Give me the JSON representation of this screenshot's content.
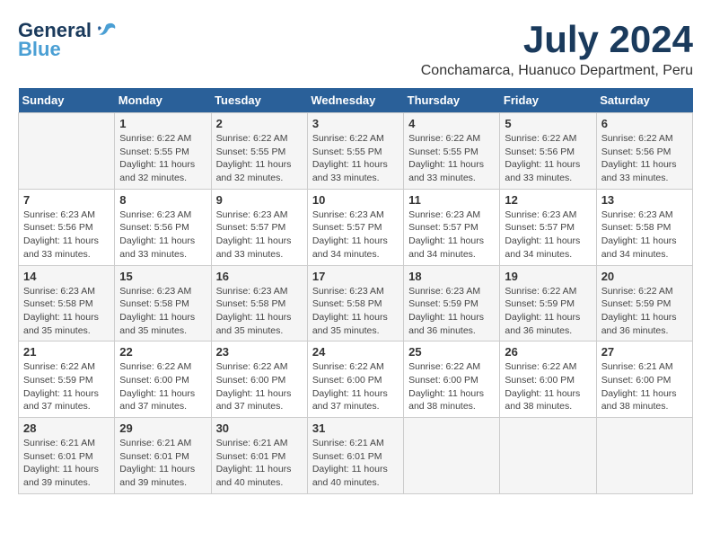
{
  "logo": {
    "general": "General",
    "blue": "Blue"
  },
  "title": {
    "month_year": "July 2024",
    "location": "Conchamarca, Huanuco Department, Peru"
  },
  "headers": [
    "Sunday",
    "Monday",
    "Tuesday",
    "Wednesday",
    "Thursday",
    "Friday",
    "Saturday"
  ],
  "weeks": [
    [
      {
        "day": "",
        "info": ""
      },
      {
        "day": "1",
        "info": "Sunrise: 6:22 AM\nSunset: 5:55 PM\nDaylight: 11 hours\nand 32 minutes."
      },
      {
        "day": "2",
        "info": "Sunrise: 6:22 AM\nSunset: 5:55 PM\nDaylight: 11 hours\nand 32 minutes."
      },
      {
        "day": "3",
        "info": "Sunrise: 6:22 AM\nSunset: 5:55 PM\nDaylight: 11 hours\nand 33 minutes."
      },
      {
        "day": "4",
        "info": "Sunrise: 6:22 AM\nSunset: 5:55 PM\nDaylight: 11 hours\nand 33 minutes."
      },
      {
        "day": "5",
        "info": "Sunrise: 6:22 AM\nSunset: 5:56 PM\nDaylight: 11 hours\nand 33 minutes."
      },
      {
        "day": "6",
        "info": "Sunrise: 6:22 AM\nSunset: 5:56 PM\nDaylight: 11 hours\nand 33 minutes."
      }
    ],
    [
      {
        "day": "7",
        "info": "Sunrise: 6:23 AM\nSunset: 5:56 PM\nDaylight: 11 hours\nand 33 minutes."
      },
      {
        "day": "8",
        "info": "Sunrise: 6:23 AM\nSunset: 5:56 PM\nDaylight: 11 hours\nand 33 minutes."
      },
      {
        "day": "9",
        "info": "Sunrise: 6:23 AM\nSunset: 5:57 PM\nDaylight: 11 hours\nand 33 minutes."
      },
      {
        "day": "10",
        "info": "Sunrise: 6:23 AM\nSunset: 5:57 PM\nDaylight: 11 hours\nand 34 minutes."
      },
      {
        "day": "11",
        "info": "Sunrise: 6:23 AM\nSunset: 5:57 PM\nDaylight: 11 hours\nand 34 minutes."
      },
      {
        "day": "12",
        "info": "Sunrise: 6:23 AM\nSunset: 5:57 PM\nDaylight: 11 hours\nand 34 minutes."
      },
      {
        "day": "13",
        "info": "Sunrise: 6:23 AM\nSunset: 5:58 PM\nDaylight: 11 hours\nand 34 minutes."
      }
    ],
    [
      {
        "day": "14",
        "info": "Sunrise: 6:23 AM\nSunset: 5:58 PM\nDaylight: 11 hours\nand 35 minutes."
      },
      {
        "day": "15",
        "info": "Sunrise: 6:23 AM\nSunset: 5:58 PM\nDaylight: 11 hours\nand 35 minutes."
      },
      {
        "day": "16",
        "info": "Sunrise: 6:23 AM\nSunset: 5:58 PM\nDaylight: 11 hours\nand 35 minutes."
      },
      {
        "day": "17",
        "info": "Sunrise: 6:23 AM\nSunset: 5:58 PM\nDaylight: 11 hours\nand 35 minutes."
      },
      {
        "day": "18",
        "info": "Sunrise: 6:23 AM\nSunset: 5:59 PM\nDaylight: 11 hours\nand 36 minutes."
      },
      {
        "day": "19",
        "info": "Sunrise: 6:22 AM\nSunset: 5:59 PM\nDaylight: 11 hours\nand 36 minutes."
      },
      {
        "day": "20",
        "info": "Sunrise: 6:22 AM\nSunset: 5:59 PM\nDaylight: 11 hours\nand 36 minutes."
      }
    ],
    [
      {
        "day": "21",
        "info": "Sunrise: 6:22 AM\nSunset: 5:59 PM\nDaylight: 11 hours\nand 37 minutes."
      },
      {
        "day": "22",
        "info": "Sunrise: 6:22 AM\nSunset: 6:00 PM\nDaylight: 11 hours\nand 37 minutes."
      },
      {
        "day": "23",
        "info": "Sunrise: 6:22 AM\nSunset: 6:00 PM\nDaylight: 11 hours\nand 37 minutes."
      },
      {
        "day": "24",
        "info": "Sunrise: 6:22 AM\nSunset: 6:00 PM\nDaylight: 11 hours\nand 37 minutes."
      },
      {
        "day": "25",
        "info": "Sunrise: 6:22 AM\nSunset: 6:00 PM\nDaylight: 11 hours\nand 38 minutes."
      },
      {
        "day": "26",
        "info": "Sunrise: 6:22 AM\nSunset: 6:00 PM\nDaylight: 11 hours\nand 38 minutes."
      },
      {
        "day": "27",
        "info": "Sunrise: 6:21 AM\nSunset: 6:00 PM\nDaylight: 11 hours\nand 38 minutes."
      }
    ],
    [
      {
        "day": "28",
        "info": "Sunrise: 6:21 AM\nSunset: 6:01 PM\nDaylight: 11 hours\nand 39 minutes."
      },
      {
        "day": "29",
        "info": "Sunrise: 6:21 AM\nSunset: 6:01 PM\nDaylight: 11 hours\nand 39 minutes."
      },
      {
        "day": "30",
        "info": "Sunrise: 6:21 AM\nSunset: 6:01 PM\nDaylight: 11 hours\nand 40 minutes."
      },
      {
        "day": "31",
        "info": "Sunrise: 6:21 AM\nSunset: 6:01 PM\nDaylight: 11 hours\nand 40 minutes."
      },
      {
        "day": "",
        "info": ""
      },
      {
        "day": "",
        "info": ""
      },
      {
        "day": "",
        "info": ""
      }
    ]
  ]
}
